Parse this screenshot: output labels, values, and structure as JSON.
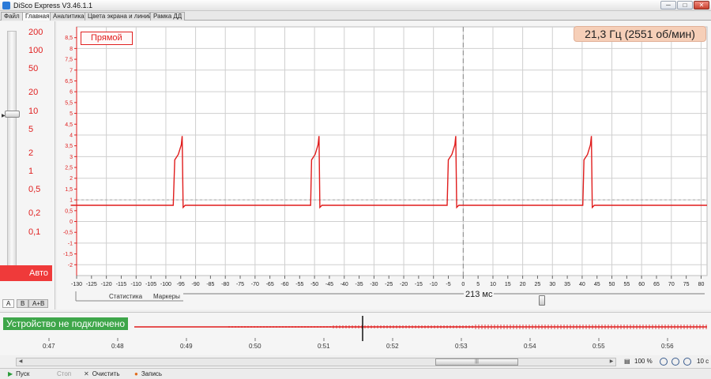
{
  "window": {
    "title": "DiSco Express V3.46.1.1",
    "min_glyph": "─",
    "max_glyph": "□",
    "close_glyph": "✕"
  },
  "menu": {
    "tabs": [
      "Файл",
      "Главная",
      "Аналитика",
      "Цвета экрана и линий",
      "Рамка ДД"
    ],
    "active_tab": "Главная"
  },
  "left_panel": {
    "scale_labels": [
      "200",
      "100",
      "50",
      "20",
      "10",
      "5",
      "2",
      "1",
      "0,5",
      "0,2",
      "0,1"
    ],
    "selected_scale": "5",
    "auto_label": "Авто",
    "channel_tabs": [
      "A",
      "B",
      "A+B"
    ],
    "active_channel": "A"
  },
  "chart": {
    "mode_label": "Прямой",
    "frequency_label": "21,3 Гц (2551 об/мин)",
    "time_scale_label": "213 мс",
    "tabs": [
      "Статистика",
      "Маркеры"
    ],
    "colors": {
      "signal": "#e01c1c",
      "grid": "#cfcfcf",
      "axis_text": "#e01c1c",
      "background": "#ffffff"
    }
  },
  "chart_data": {
    "type": "line",
    "xlabel": "",
    "ylabel": "",
    "xlim": [
      -130,
      82
    ],
    "ylim": [
      -2.5,
      9
    ],
    "x_ticks": [
      -130,
      -125,
      -120,
      -115,
      -110,
      -105,
      -100,
      -95,
      -90,
      -85,
      -80,
      -75,
      -70,
      -65,
      -60,
      -55,
      -50,
      -45,
      -40,
      -35,
      -30,
      -25,
      -20,
      -15,
      -10,
      -5,
      0,
      5,
      10,
      15,
      20,
      25,
      30,
      35,
      40,
      45,
      50,
      55,
      60,
      65,
      70,
      75,
      80
    ],
    "y_ticks": [
      8.5,
      8,
      7.5,
      7,
      6.5,
      6,
      5.5,
      5,
      4.5,
      4,
      3.5,
      3,
      2.5,
      2,
      1.5,
      1,
      0.5,
      0,
      -0.5,
      -1,
      -1.5,
      -2
    ],
    "grid": true,
    "cursor_x": 0,
    "series": [
      {
        "x": [
          -132,
          -97.5,
          -97,
          -95.8,
          -94.8,
          -94.5,
          -94.2,
          -93.5,
          -54,
          -51.3,
          -51,
          -49.8,
          -48.8,
          -48.5,
          -48.2,
          -47.5,
          -8,
          -5.4,
          -5,
          -3.8,
          -2.8,
          -2.5,
          -2.2,
          -1.5,
          38,
          40.2,
          40.6,
          41.8,
          42.8,
          43.1,
          43.4,
          44.1,
          82
        ],
        "y": [
          0.75,
          0.75,
          2.85,
          3.1,
          3.55,
          3.95,
          0.65,
          0.75,
          0.75,
          0.75,
          2.85,
          3.1,
          3.55,
          3.95,
          0.65,
          0.75,
          0.75,
          0.75,
          2.85,
          3.1,
          3.55,
          3.95,
          0.65,
          0.75,
          0.75,
          0.75,
          2.85,
          3.1,
          3.55,
          3.95,
          0.65,
          0.75,
          0.75
        ]
      }
    ]
  },
  "timeline": {
    "device_status": "Устройство не подключено",
    "ticks": [
      "0:47",
      "0:48",
      "0:49",
      "0:50",
      "0:51",
      "0:52",
      "0:53",
      "0:54",
      "0:55",
      "0:56"
    ],
    "zoom_percent": "100 %",
    "window_seconds": "10 с"
  },
  "toolbar": {
    "start": "Пуск",
    "stop": "Стоп",
    "clear": "Очистить",
    "record": "Запись"
  }
}
